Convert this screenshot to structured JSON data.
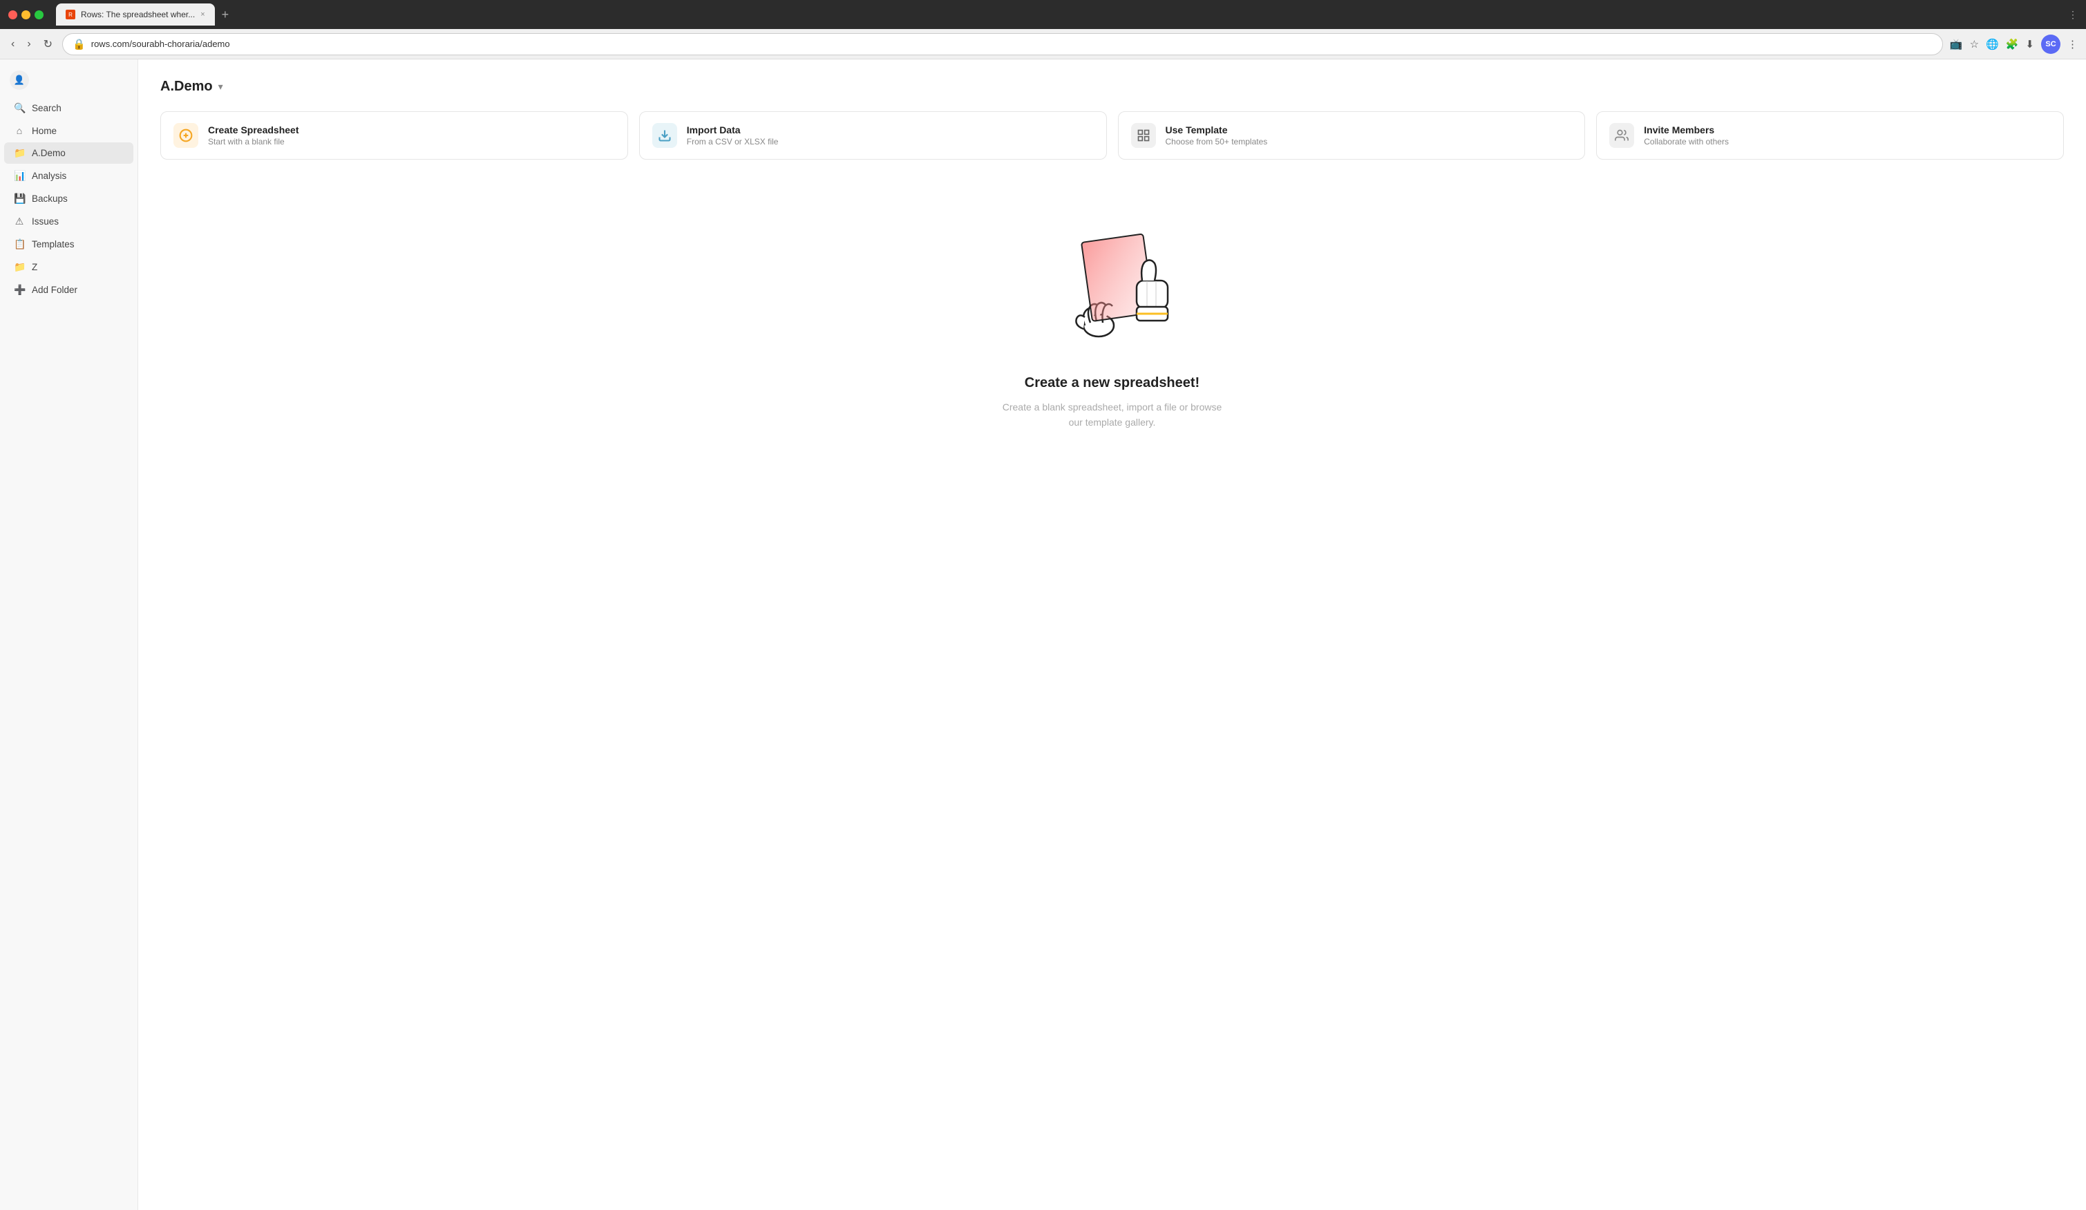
{
  "browser": {
    "tab_favicon": "R",
    "tab_title": "Rows: The spreadsheet wher...",
    "tab_close": "×",
    "tab_new": "+",
    "address": "rows.com/sourabh-choraria/ademo",
    "profile_initials": "SC"
  },
  "sidebar": {
    "user_icon": "👤",
    "search_label": "Search",
    "home_label": "Home",
    "ademo_label": "A.Demo",
    "analysis_label": "Analysis",
    "backups_label": "Backups",
    "issues_label": "Issues",
    "templates_label": "Templates",
    "z_label": "Z",
    "add_folder_label": "Add Folder"
  },
  "page": {
    "title": "A.Demo",
    "title_arrow": "▾"
  },
  "action_cards": [
    {
      "id": "create",
      "icon": "＋",
      "title": "Create Spreadsheet",
      "subtitle": "Start with a blank file"
    },
    {
      "id": "import",
      "icon": "⬇",
      "title": "Import Data",
      "subtitle": "From a CSV or XLSX file"
    },
    {
      "id": "template",
      "icon": "▦",
      "title": "Use Template",
      "subtitle": "Choose from 50+ templates"
    },
    {
      "id": "invite",
      "icon": "👥",
      "title": "Invite Members",
      "subtitle": "Collaborate with others"
    }
  ],
  "empty_state": {
    "title": "Create a new spreadsheet!",
    "subtitle": "Create a blank spreadsheet, import a file or browse our template gallery."
  }
}
